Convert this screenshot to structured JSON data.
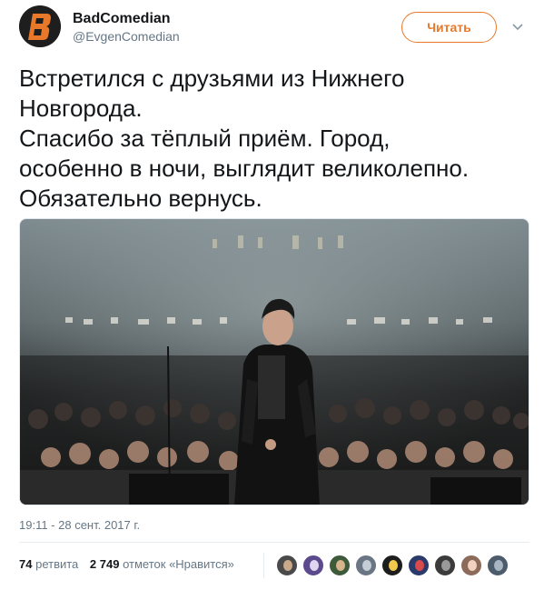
{
  "user": {
    "display_name": "BadComedian",
    "screen_name": "@EvgenComedian",
    "avatar_icon": "badcomedian-logo-avatar"
  },
  "follow_button": {
    "label": "Читать"
  },
  "caret_icon": "chevron-down-icon",
  "tweet": {
    "lines": [
      "Встретился с друзьями из Нижнего",
      "Новгорода.",
      "Спасибо за тёплый приём. Город,",
      "особенно в ночи, выглядит великолепно.",
      "Обязательно вернусь."
    ]
  },
  "media": {
    "description_icon": "concert-stage-photo"
  },
  "timestamp": "19:11 - 28 сент. 2017 г.",
  "stats": {
    "retweets_count": "74",
    "retweets_label": "ретвита",
    "likes_count": "2 749",
    "likes_label": "отметок «Нравится»"
  },
  "likers": [
    {
      "name": "liker-1",
      "bg": "#4a4a4a",
      "fg": "#c9a98a"
    },
    {
      "name": "liker-2",
      "bg": "#5b4a8c",
      "fg": "#e0d6f2"
    },
    {
      "name": "liker-3",
      "bg": "#3d5a3a",
      "fg": "#d6b48c"
    },
    {
      "name": "liker-4",
      "bg": "#6a7683",
      "fg": "#c4ccd5"
    },
    {
      "name": "liker-5",
      "bg": "#1d1d1d",
      "fg": "#f2c94c"
    },
    {
      "name": "liker-6",
      "bg": "#2a3a6b",
      "fg": "#d94b4b"
    },
    {
      "name": "liker-7",
      "bg": "#3b3b3b",
      "fg": "#9a9a9a"
    },
    {
      "name": "liker-8",
      "bg": "#8c6b5b",
      "fg": "#f0d2bf"
    },
    {
      "name": "liker-9",
      "bg": "#4d5c6b",
      "fg": "#a8b6c4"
    }
  ],
  "colors": {
    "accent": "#e8792a",
    "secondary_text": "#657786",
    "primary_text": "#14171a"
  }
}
